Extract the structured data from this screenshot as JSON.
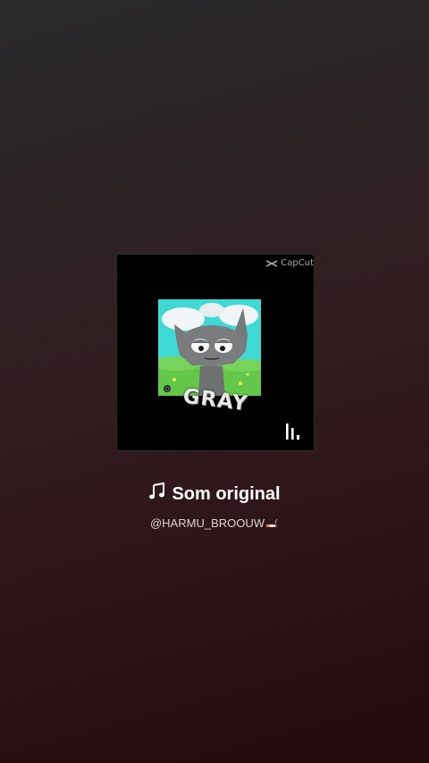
{
  "sound": {
    "title": "Som original",
    "author": "@HARMU_BROOUW",
    "note_icon": "music-note-icon",
    "author_emoji_icon": "cigarette-icon"
  },
  "cover": {
    "watermark": "CapCut",
    "caption": "GRAY",
    "equalizer_icon": "equalizer-bars-icon"
  },
  "colors": {
    "background_top": "#2a2a2c",
    "background_bottom": "#240a0d",
    "title_text": "#ffffff",
    "author_text": "#d9d4d4"
  }
}
